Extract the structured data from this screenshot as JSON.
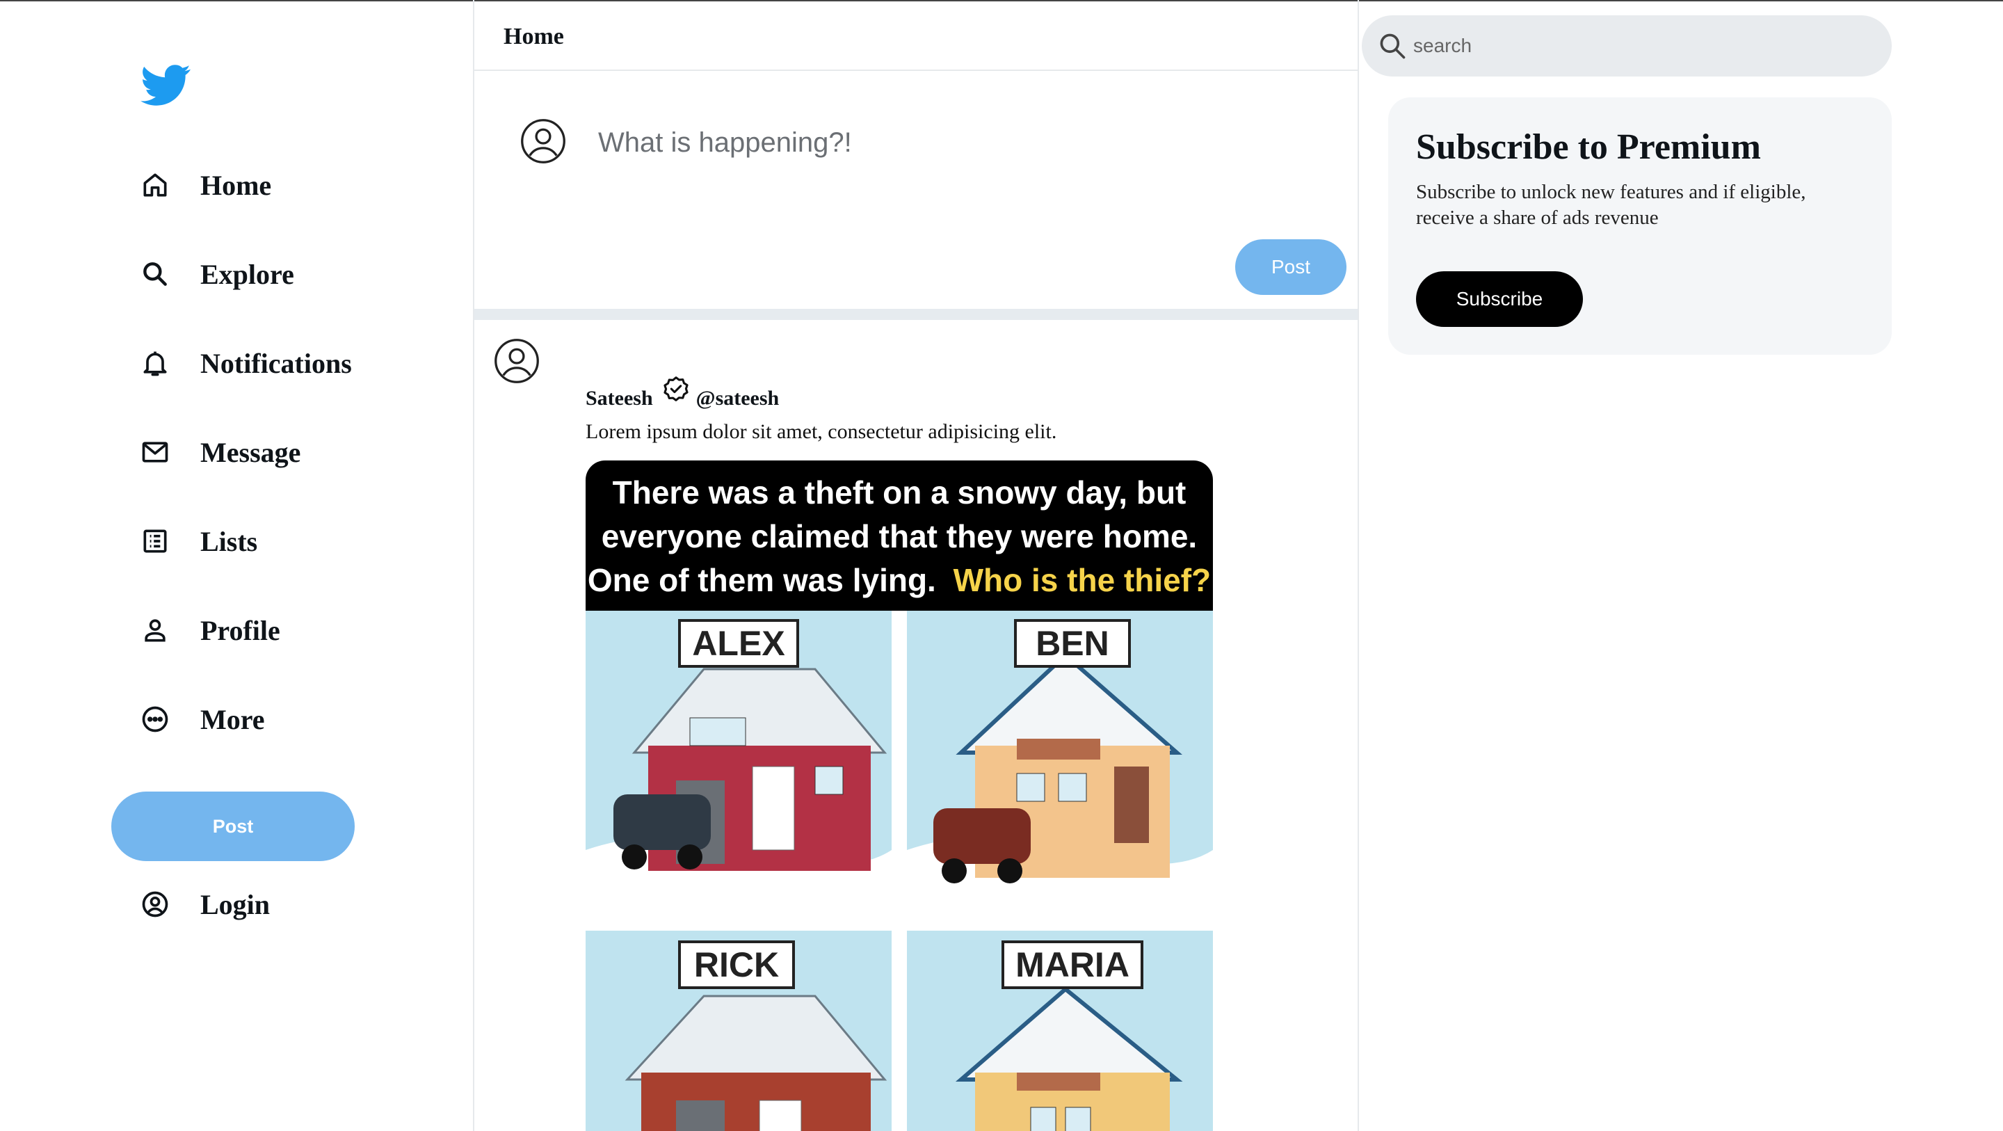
{
  "sidebar": {
    "logo_icon": "bird-logo-icon",
    "nav_items": [
      {
        "label": "Home",
        "icon": "home-icon"
      },
      {
        "label": "Explore",
        "icon": "search-icon"
      },
      {
        "label": "Notifications",
        "icon": "bell-icon"
      },
      {
        "label": "Message",
        "icon": "mail-icon"
      },
      {
        "label": "Lists",
        "icon": "list-icon"
      },
      {
        "label": "Profile",
        "icon": "person-icon"
      },
      {
        "label": "More",
        "icon": "more-icon"
      }
    ],
    "post_label": "Post",
    "login": {
      "label": "Login",
      "icon": "account-circle-icon"
    }
  },
  "center": {
    "title": "Home",
    "composer": {
      "placeholder": "What is happening?!",
      "post_label": "Post"
    },
    "tweet": {
      "name": "Sateesh",
      "handle": "@sateesh",
      "text": "Lorem ipsum dolor sit amet, consectetur adipisicing elit.",
      "media": {
        "caption_line1": "There was a theft on a snowy day, but",
        "caption_line2": "everyone claimed that they were home.",
        "caption_line3_a": "One of them was lying.",
        "caption_line3_b": "Who is the thief?",
        "houses": [
          "ALEX",
          "BEN",
          "RICK",
          "MARIA"
        ]
      }
    }
  },
  "right": {
    "search_placeholder": "search",
    "premium": {
      "title": "Subscribe to Premium",
      "description": "Subscribe to unlock new features and if eligible, receive a share of ads revenue",
      "button_label": "Subscribe"
    }
  },
  "colors": {
    "brand_blue": "#1d9bf0",
    "post_button": "#74b6ee",
    "divider": "#e6ebef",
    "caption_highlight": "#f6d34a"
  }
}
